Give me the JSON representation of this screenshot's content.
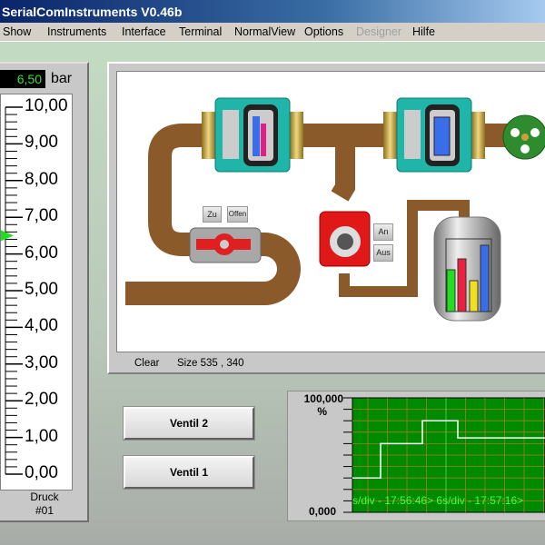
{
  "window": {
    "title": "SerialComInstruments  V0.46b"
  },
  "menu": [
    {
      "label": "Show",
      "enabled": true
    },
    {
      "label": "Instruments",
      "enabled": true
    },
    {
      "label": "Interface",
      "enabled": true
    },
    {
      "label": "Terminal",
      "enabled": true
    },
    {
      "label": "NormalView",
      "enabled": true
    },
    {
      "label": "Options",
      "enabled": true
    },
    {
      "label": "Designer",
      "enabled": false
    },
    {
      "label": "Hilfe",
      "enabled": true
    }
  ],
  "gauge": {
    "value": 6.5,
    "display": "6,50",
    "unit": "bar",
    "min": 0,
    "max": 10,
    "labels": [
      "10,00",
      "9,00",
      "8,00",
      "7,00",
      "6,00",
      "5,00",
      "4,00",
      "3,00",
      "2,00",
      "1,00",
      "0,00"
    ],
    "name": "Druck",
    "id": "#01",
    "pointer_color": "#22dd22"
  },
  "process": {
    "valve_buttons": {
      "close": "Zu",
      "open": "Offen"
    },
    "pump_buttons": {
      "on": "An",
      "off": "Aus"
    },
    "status": {
      "clear": "Clear",
      "size": "Size 535 , 340"
    },
    "colors": {
      "pipe": "#8b5a2b",
      "meter": "#1fb5a8",
      "pump": "#e01818",
      "wheel": "#2e8b2e"
    }
  },
  "buttons": {
    "ventil2": "Ventil 2",
    "ventil1": "Ventil 1"
  },
  "chart_data": {
    "type": "line",
    "ylim": [
      0,
      100
    ],
    "ymax_label": "100,000",
    "ymin_label": "0,000",
    "ylabel": "%",
    "x_caption": "s/div - 17:56:46> 6s/div - 17:57:16>",
    "step": true,
    "values": [
      30,
      30,
      60,
      60,
      80,
      80,
      65,
      65
    ],
    "background": "#008a00",
    "line_color": "#ffffff",
    "grid": true
  }
}
